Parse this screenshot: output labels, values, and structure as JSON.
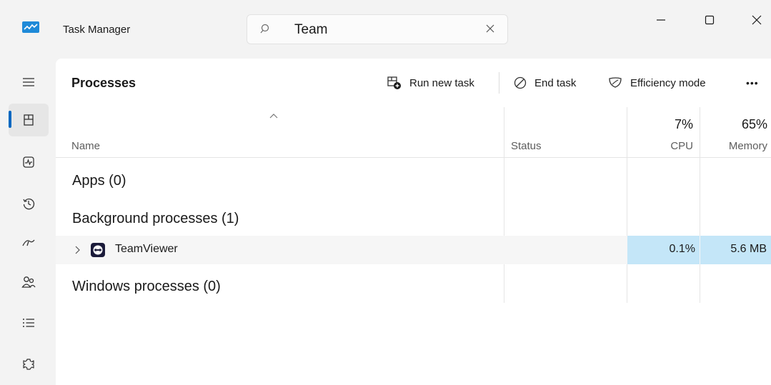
{
  "window": {
    "title": "Task Manager",
    "icon": "task-manager-icon",
    "controls": [
      "minimize-icon",
      "maximize-icon",
      "close-icon"
    ]
  },
  "search": {
    "value": "Team",
    "icon": "search-icon",
    "clear_icon": "clear-icon"
  },
  "sidebar": {
    "items": [
      {
        "name": "menu",
        "icon": "hamburger-icon"
      },
      {
        "name": "processes",
        "icon": "processes-icon",
        "active": true
      },
      {
        "name": "performance",
        "icon": "performance-icon"
      },
      {
        "name": "app-history",
        "icon": "history-icon"
      },
      {
        "name": "startup-apps",
        "icon": "startup-icon"
      },
      {
        "name": "users",
        "icon": "users-icon"
      },
      {
        "name": "details",
        "icon": "details-icon"
      },
      {
        "name": "services",
        "icon": "services-icon"
      }
    ]
  },
  "header": {
    "title": "Processes",
    "run_new_task": "Run new task",
    "end_task": "End task",
    "efficiency_mode": "Efficiency mode",
    "more": "•••"
  },
  "table": {
    "columns": {
      "name": "Name",
      "status": "Status",
      "cpu_pct": "7%",
      "cpu": "CPU",
      "memory_pct": "65%",
      "memory": "Memory"
    },
    "groups": {
      "apps": "Apps (0)",
      "background": "Background processes (1)",
      "windows": "Windows processes (0)"
    },
    "rows": [
      {
        "name": "TeamViewer",
        "status": "",
        "cpu": "0.1%",
        "memory": "5.6 MB",
        "icon": "teamviewer-icon"
      }
    ]
  },
  "colors": {
    "accent": "#0067c0",
    "heat": "#c4e6f8",
    "background": "#f3f3f3"
  }
}
